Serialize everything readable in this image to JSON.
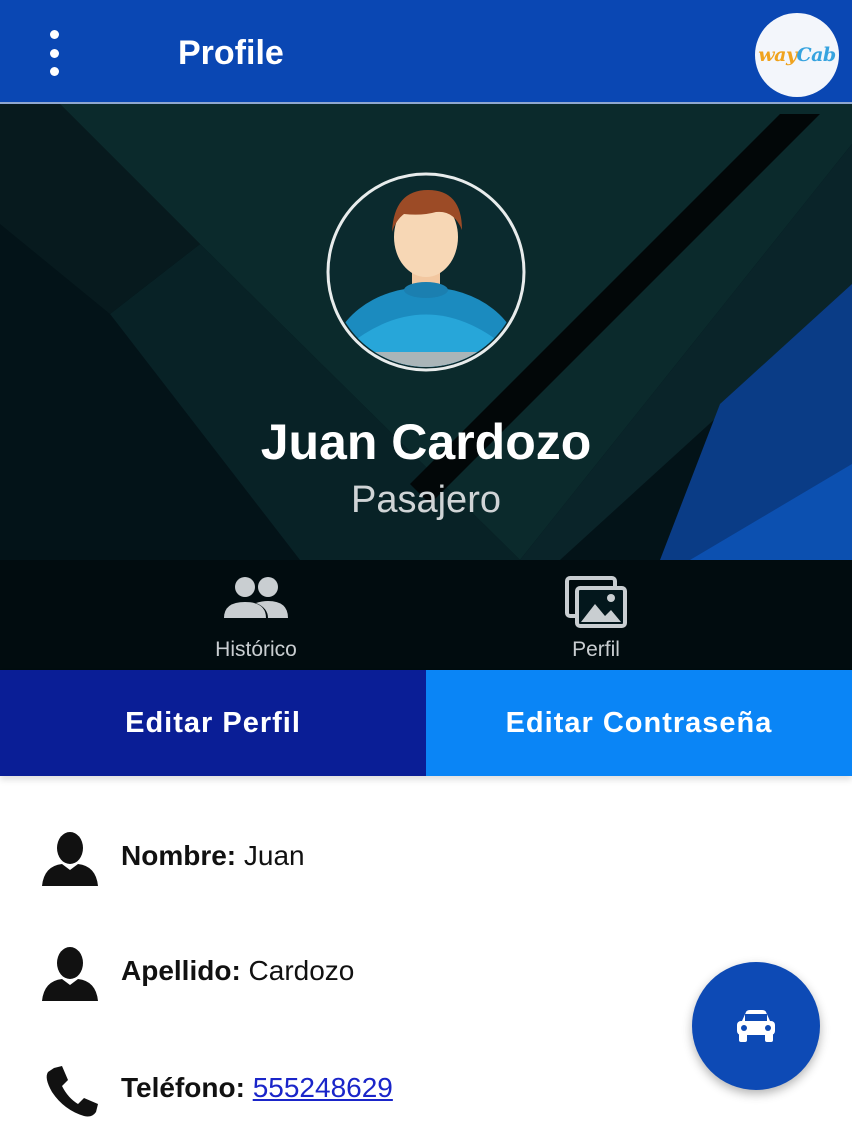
{
  "header": {
    "title": "Profile",
    "logo_text_a": "way",
    "logo_text_b": "Cab"
  },
  "profile": {
    "name": "Juan Cardozo",
    "role": "Pasajero"
  },
  "tabs": [
    {
      "label": "Histórico",
      "icon": "people-icon"
    },
    {
      "label": "Perfil",
      "icon": "photos-icon"
    }
  ],
  "actions": {
    "edit_profile": "Editar Perfil",
    "edit_password": "Editar Contraseña"
  },
  "details": [
    {
      "label": "Nombre:",
      "value": "Juan",
      "icon": "person-icon"
    },
    {
      "label": "Apellido:",
      "value": "Cardozo",
      "icon": "person-icon"
    },
    {
      "label": "Teléfono:",
      "value": "555248629",
      "icon": "phone-icon"
    }
  ],
  "fab": {
    "icon": "car-icon"
  },
  "colors": {
    "topbar": "#0a47b3",
    "edit_profile_bg": "#0a1e96",
    "edit_password_bg": "#0a85f6",
    "fab_bg": "#0d4ab5",
    "link": "#1a25c9"
  }
}
